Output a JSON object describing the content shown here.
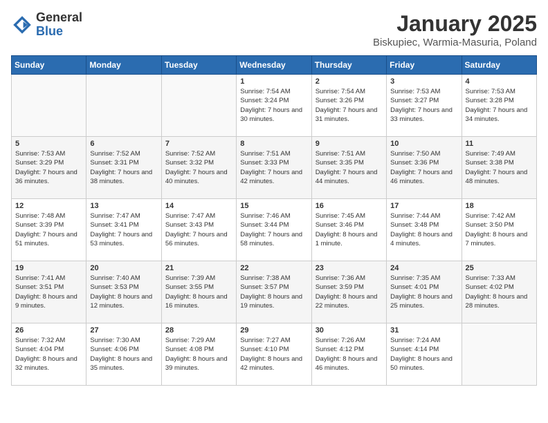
{
  "logo": {
    "general": "General",
    "blue": "Blue"
  },
  "title": "January 2025",
  "subtitle": "Biskupiec, Warmia-Masuria, Poland",
  "weekdays": [
    "Sunday",
    "Monday",
    "Tuesday",
    "Wednesday",
    "Thursday",
    "Friday",
    "Saturday"
  ],
  "weeks": [
    [
      {
        "day": "",
        "sunrise": "",
        "sunset": "",
        "daylight": ""
      },
      {
        "day": "",
        "sunrise": "",
        "sunset": "",
        "daylight": ""
      },
      {
        "day": "",
        "sunrise": "",
        "sunset": "",
        "daylight": ""
      },
      {
        "day": "1",
        "sunrise": "Sunrise: 7:54 AM",
        "sunset": "Sunset: 3:24 PM",
        "daylight": "Daylight: 7 hours and 30 minutes."
      },
      {
        "day": "2",
        "sunrise": "Sunrise: 7:54 AM",
        "sunset": "Sunset: 3:26 PM",
        "daylight": "Daylight: 7 hours and 31 minutes."
      },
      {
        "day": "3",
        "sunrise": "Sunrise: 7:53 AM",
        "sunset": "Sunset: 3:27 PM",
        "daylight": "Daylight: 7 hours and 33 minutes."
      },
      {
        "day": "4",
        "sunrise": "Sunrise: 7:53 AM",
        "sunset": "Sunset: 3:28 PM",
        "daylight": "Daylight: 7 hours and 34 minutes."
      }
    ],
    [
      {
        "day": "5",
        "sunrise": "Sunrise: 7:53 AM",
        "sunset": "Sunset: 3:29 PM",
        "daylight": "Daylight: 7 hours and 36 minutes."
      },
      {
        "day": "6",
        "sunrise": "Sunrise: 7:52 AM",
        "sunset": "Sunset: 3:31 PM",
        "daylight": "Daylight: 7 hours and 38 minutes."
      },
      {
        "day": "7",
        "sunrise": "Sunrise: 7:52 AM",
        "sunset": "Sunset: 3:32 PM",
        "daylight": "Daylight: 7 hours and 40 minutes."
      },
      {
        "day": "8",
        "sunrise": "Sunrise: 7:51 AM",
        "sunset": "Sunset: 3:33 PM",
        "daylight": "Daylight: 7 hours and 42 minutes."
      },
      {
        "day": "9",
        "sunrise": "Sunrise: 7:51 AM",
        "sunset": "Sunset: 3:35 PM",
        "daylight": "Daylight: 7 hours and 44 minutes."
      },
      {
        "day": "10",
        "sunrise": "Sunrise: 7:50 AM",
        "sunset": "Sunset: 3:36 PM",
        "daylight": "Daylight: 7 hours and 46 minutes."
      },
      {
        "day": "11",
        "sunrise": "Sunrise: 7:49 AM",
        "sunset": "Sunset: 3:38 PM",
        "daylight": "Daylight: 7 hours and 48 minutes."
      }
    ],
    [
      {
        "day": "12",
        "sunrise": "Sunrise: 7:48 AM",
        "sunset": "Sunset: 3:39 PM",
        "daylight": "Daylight: 7 hours and 51 minutes."
      },
      {
        "day": "13",
        "sunrise": "Sunrise: 7:47 AM",
        "sunset": "Sunset: 3:41 PM",
        "daylight": "Daylight: 7 hours and 53 minutes."
      },
      {
        "day": "14",
        "sunrise": "Sunrise: 7:47 AM",
        "sunset": "Sunset: 3:43 PM",
        "daylight": "Daylight: 7 hours and 56 minutes."
      },
      {
        "day": "15",
        "sunrise": "Sunrise: 7:46 AM",
        "sunset": "Sunset: 3:44 PM",
        "daylight": "Daylight: 7 hours and 58 minutes."
      },
      {
        "day": "16",
        "sunrise": "Sunrise: 7:45 AM",
        "sunset": "Sunset: 3:46 PM",
        "daylight": "Daylight: 8 hours and 1 minute."
      },
      {
        "day": "17",
        "sunrise": "Sunrise: 7:44 AM",
        "sunset": "Sunset: 3:48 PM",
        "daylight": "Daylight: 8 hours and 4 minutes."
      },
      {
        "day": "18",
        "sunrise": "Sunrise: 7:42 AM",
        "sunset": "Sunset: 3:50 PM",
        "daylight": "Daylight: 8 hours and 7 minutes."
      }
    ],
    [
      {
        "day": "19",
        "sunrise": "Sunrise: 7:41 AM",
        "sunset": "Sunset: 3:51 PM",
        "daylight": "Daylight: 8 hours and 9 minutes."
      },
      {
        "day": "20",
        "sunrise": "Sunrise: 7:40 AM",
        "sunset": "Sunset: 3:53 PM",
        "daylight": "Daylight: 8 hours and 12 minutes."
      },
      {
        "day": "21",
        "sunrise": "Sunrise: 7:39 AM",
        "sunset": "Sunset: 3:55 PM",
        "daylight": "Daylight: 8 hours and 16 minutes."
      },
      {
        "day": "22",
        "sunrise": "Sunrise: 7:38 AM",
        "sunset": "Sunset: 3:57 PM",
        "daylight": "Daylight: 8 hours and 19 minutes."
      },
      {
        "day": "23",
        "sunrise": "Sunrise: 7:36 AM",
        "sunset": "Sunset: 3:59 PM",
        "daylight": "Daylight: 8 hours and 22 minutes."
      },
      {
        "day": "24",
        "sunrise": "Sunrise: 7:35 AM",
        "sunset": "Sunset: 4:01 PM",
        "daylight": "Daylight: 8 hours and 25 minutes."
      },
      {
        "day": "25",
        "sunrise": "Sunrise: 7:33 AM",
        "sunset": "Sunset: 4:02 PM",
        "daylight": "Daylight: 8 hours and 28 minutes."
      }
    ],
    [
      {
        "day": "26",
        "sunrise": "Sunrise: 7:32 AM",
        "sunset": "Sunset: 4:04 PM",
        "daylight": "Daylight: 8 hours and 32 minutes."
      },
      {
        "day": "27",
        "sunrise": "Sunrise: 7:30 AM",
        "sunset": "Sunset: 4:06 PM",
        "daylight": "Daylight: 8 hours and 35 minutes."
      },
      {
        "day": "28",
        "sunrise": "Sunrise: 7:29 AM",
        "sunset": "Sunset: 4:08 PM",
        "daylight": "Daylight: 8 hours and 39 minutes."
      },
      {
        "day": "29",
        "sunrise": "Sunrise: 7:27 AM",
        "sunset": "Sunset: 4:10 PM",
        "daylight": "Daylight: 8 hours and 42 minutes."
      },
      {
        "day": "30",
        "sunrise": "Sunrise: 7:26 AM",
        "sunset": "Sunset: 4:12 PM",
        "daylight": "Daylight: 8 hours and 46 minutes."
      },
      {
        "day": "31",
        "sunrise": "Sunrise: 7:24 AM",
        "sunset": "Sunset: 4:14 PM",
        "daylight": "Daylight: 8 hours and 50 minutes."
      },
      {
        "day": "",
        "sunrise": "",
        "sunset": "",
        "daylight": ""
      }
    ]
  ]
}
